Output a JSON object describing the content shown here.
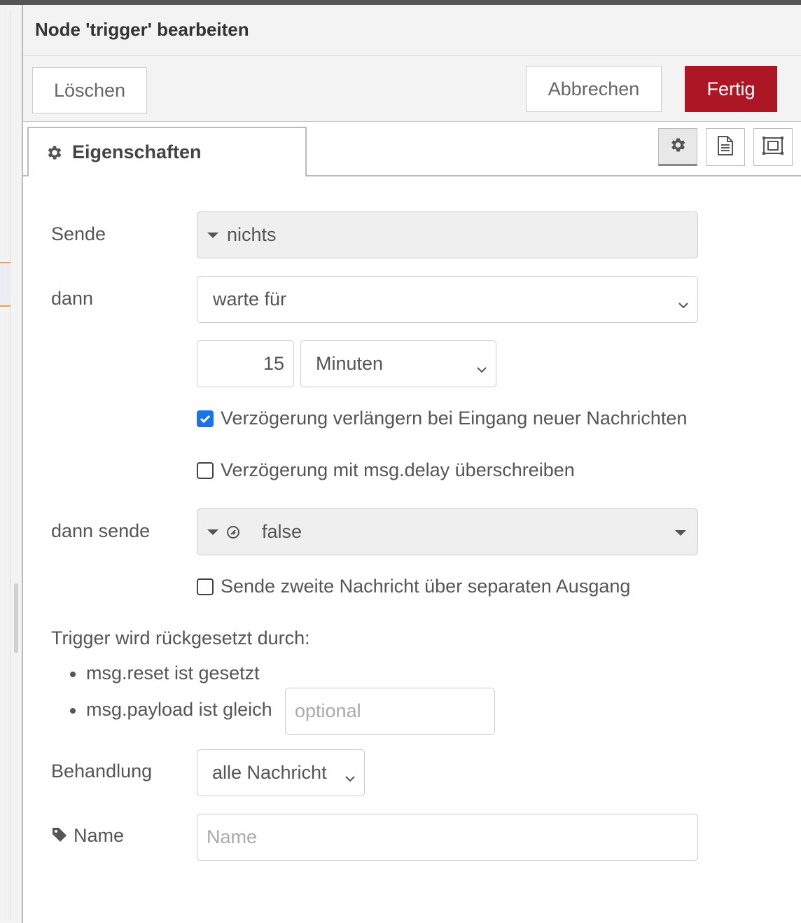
{
  "dialog": {
    "title": "Node 'trigger' bearbeiten",
    "buttons": {
      "delete": "Löschen",
      "cancel": "Abbrechen",
      "done": "Fertig"
    },
    "tab_label": "Eigenschaften"
  },
  "form": {
    "send": {
      "label": "Sende",
      "value": "nichts"
    },
    "then": {
      "label": "dann",
      "value": "warte für"
    },
    "delay": {
      "amount": "15",
      "unit": "Minuten"
    },
    "extend_checkbox": {
      "label": "Verzögerung verlängern bei Eingang neuer Nachrichten",
      "checked": true
    },
    "override_checkbox": {
      "label": "Verzögerung mit msg.delay überschreiben",
      "checked": false
    },
    "then_send": {
      "label": "dann sende",
      "value": "false"
    },
    "second_output_checkbox": {
      "label": "Sende zweite Nachricht über separaten Ausgang",
      "checked": false
    },
    "reset": {
      "heading": "Trigger wird rückgesetzt durch:",
      "item1": "msg.reset ist gesetzt",
      "item2": "msg.payload ist gleich",
      "payload_placeholder": "optional"
    },
    "handling": {
      "label": "Behandlung",
      "value": "alle Nachricht"
    },
    "name": {
      "label": "Name",
      "placeholder": "Name"
    }
  },
  "colors": {
    "accent": "#ad1625",
    "checkbox": "#1a73e8"
  }
}
